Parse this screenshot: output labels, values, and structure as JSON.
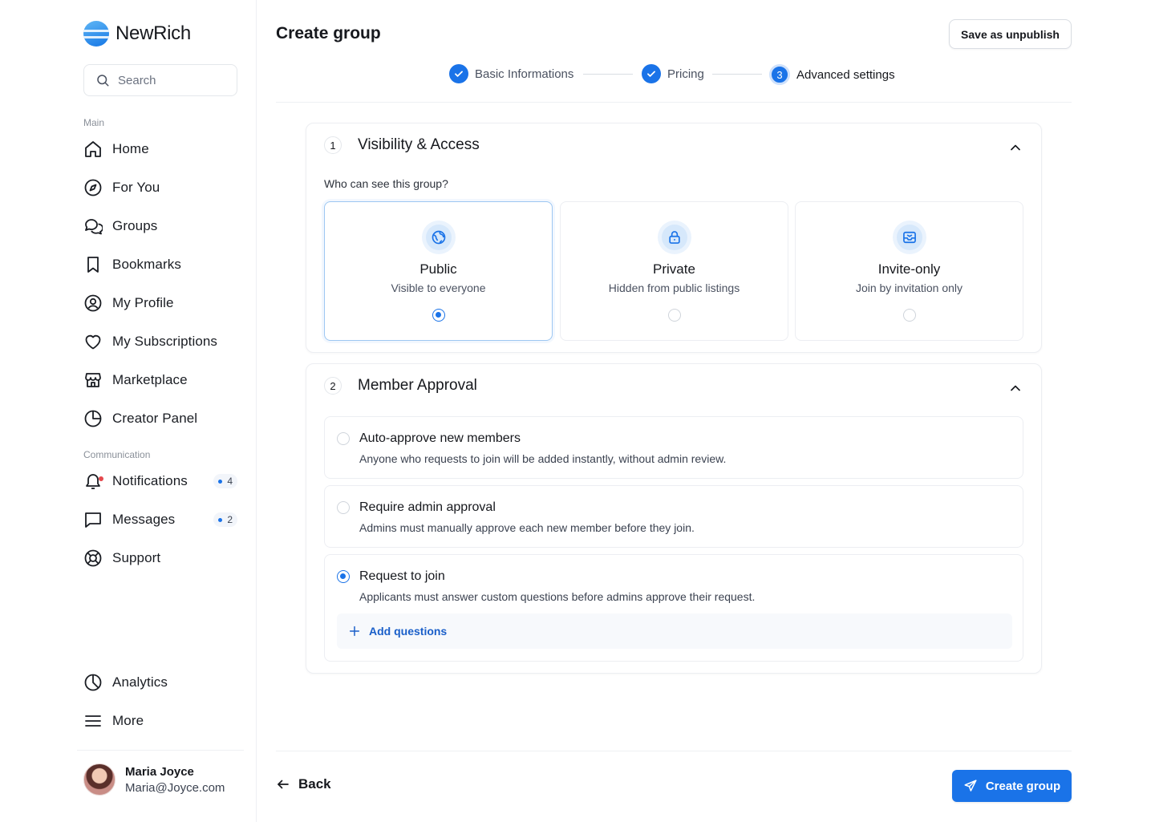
{
  "app": {
    "name": "NewRich"
  },
  "search": {
    "placeholder": "Search"
  },
  "sidebar": {
    "section_main": "Main",
    "section_communication": "Communication",
    "items": [
      {
        "label": "Home",
        "icon": "home-icon"
      },
      {
        "label": "For You",
        "icon": "compass-icon"
      },
      {
        "label": "Groups",
        "icon": "chat-bubbles-icon"
      },
      {
        "label": "Bookmarks",
        "icon": "bookmark-icon"
      },
      {
        "label": "My Profile",
        "icon": "user-circle-icon"
      },
      {
        "label": "My Subscriptions",
        "icon": "heart-icon"
      },
      {
        "label": "Marketplace",
        "icon": "store-icon"
      },
      {
        "label": "Creator Panel",
        "icon": "pie-chart-icon"
      }
    ],
    "comm_items": [
      {
        "label": "Notifications",
        "icon": "bell-icon",
        "badge": "4"
      },
      {
        "label": "Messages",
        "icon": "message-icon",
        "badge": "2"
      },
      {
        "label": "Support",
        "icon": "lifebuoy-icon"
      }
    ],
    "bottom_items": [
      {
        "label": "Analytics",
        "icon": "analytics-icon"
      },
      {
        "label": "More",
        "icon": "menu-icon"
      }
    ]
  },
  "user": {
    "name": "Maria Joyce",
    "email": "Maria@Joyce.com"
  },
  "header": {
    "title": "Create group",
    "save_label": "Save as unpublish"
  },
  "stepper": {
    "steps": [
      {
        "label": "Basic Informations",
        "state": "done"
      },
      {
        "label": "Pricing",
        "state": "done"
      },
      {
        "label": "Advanced settings",
        "state": "active",
        "number": "3"
      }
    ]
  },
  "visibility": {
    "number": "1",
    "title": "Visibility & Access",
    "question": "Who can see this group?",
    "options": [
      {
        "title": "Public",
        "subtitle": "Visible to everyone",
        "icon": "globe-icon",
        "selected": true
      },
      {
        "title": "Private",
        "subtitle": "Hidden from public listings",
        "icon": "lock-icon",
        "selected": false
      },
      {
        "title": "Invite-only",
        "subtitle": "Join by invitation only",
        "icon": "inbox-icon",
        "selected": false
      }
    ]
  },
  "approval": {
    "number": "2",
    "title": "Member Approval",
    "options": [
      {
        "title": "Auto-approve new members",
        "subtitle": "Anyone who requests to join will be added instantly, without admin review.",
        "selected": false
      },
      {
        "title": "Require admin approval",
        "subtitle": "Admins must manually approve each new member before they join.",
        "selected": false
      },
      {
        "title": "Request to join",
        "subtitle": "Applicants must answer custom questions before admins approve their request.",
        "selected": true
      }
    ],
    "add_questions_label": "Add questions"
  },
  "footer": {
    "back_label": "Back",
    "create_label": "Create group"
  },
  "colors": {
    "accent": "#1a73e8",
    "badge_dot": "#1a73e8",
    "alert_dot": "#e5484d"
  }
}
